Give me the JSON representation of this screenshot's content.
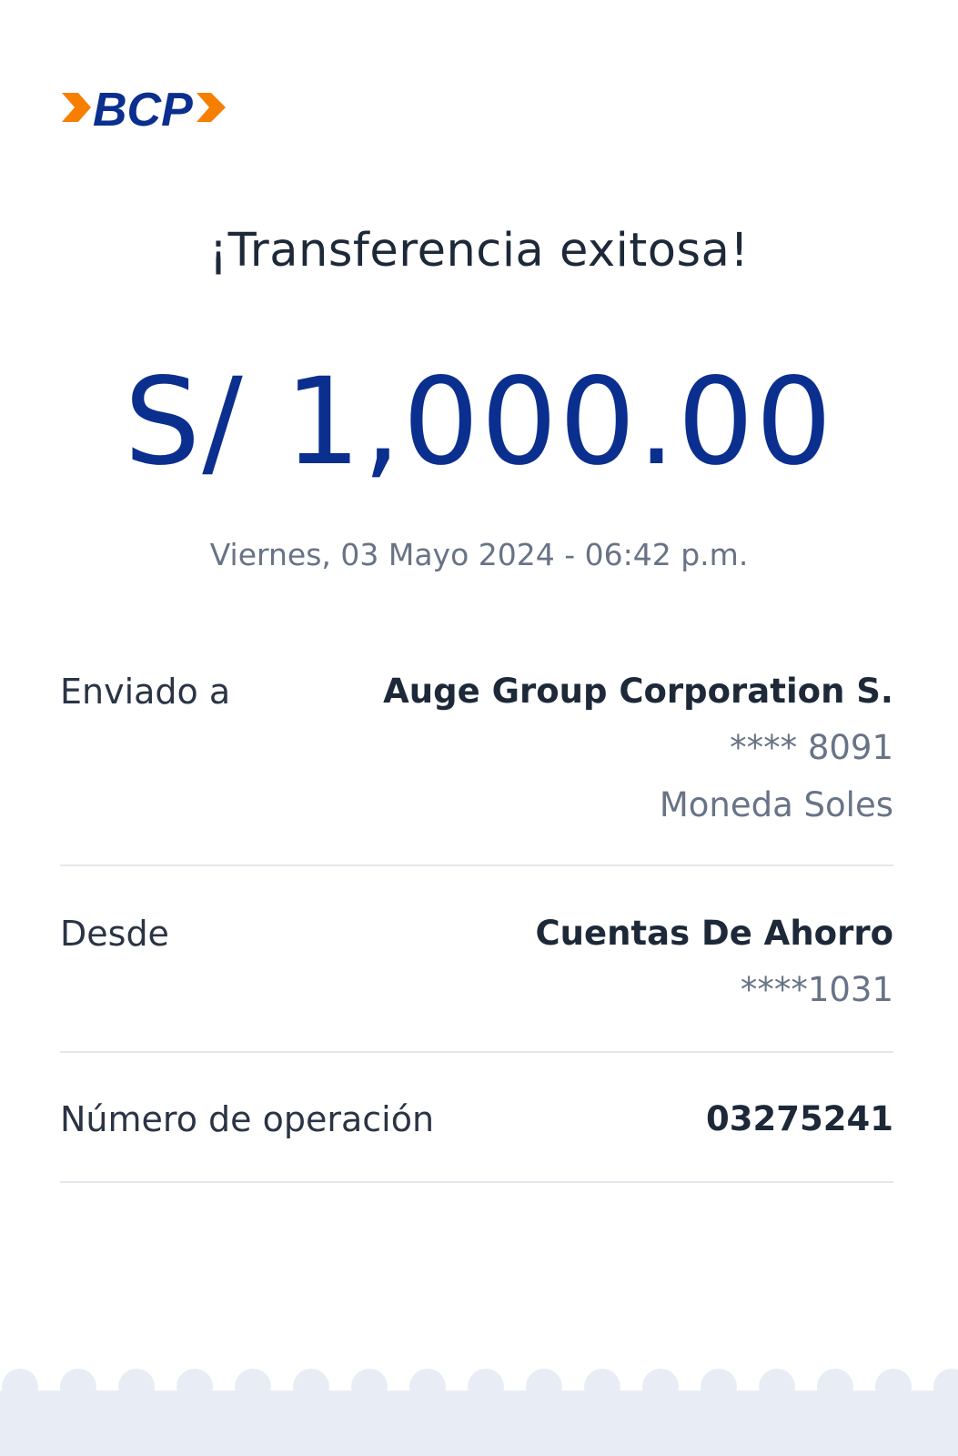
{
  "brand": {
    "name": "BCP",
    "colors": {
      "brand_blue": "#0b2f8f",
      "brand_orange": "#f77f00",
      "text_dark": "#1d2939",
      "text_muted": "#687386",
      "divider": "#e4e7ec",
      "footer": "#e8edf5"
    }
  },
  "header": {
    "title": "¡Transferencia exitosa!"
  },
  "transfer": {
    "amount": "S/ 1,000.00",
    "datetime": "Viernes, 03 Mayo 2024 - 06:42 p.m."
  },
  "details": {
    "sent_to": {
      "label": "Enviado a",
      "name": "Auge Group Corporation S.",
      "account": "**** 8091",
      "currency": "Moneda Soles"
    },
    "from": {
      "label": "Desde",
      "account_type": "Cuentas De Ahorro",
      "account": "****1031"
    },
    "operation": {
      "label": "Número de operación",
      "number": "03275241"
    }
  }
}
